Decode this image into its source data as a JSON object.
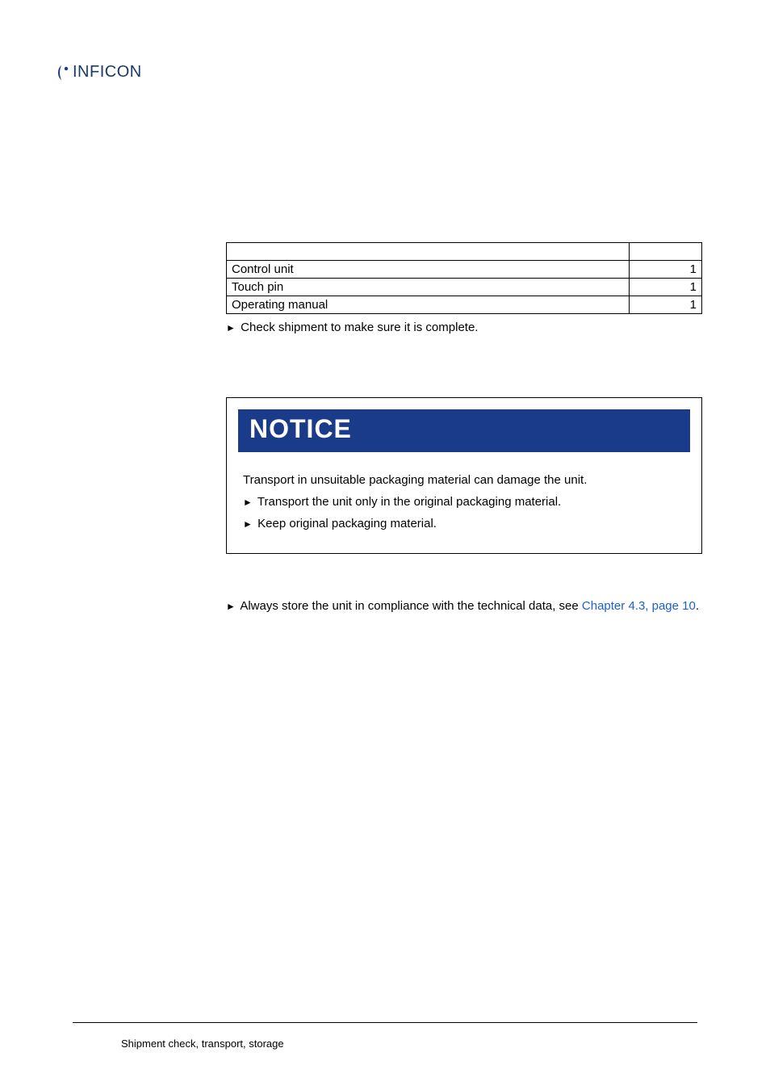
{
  "brand": "INFICON",
  "shipment_table": {
    "rows": [
      {
        "item": "Control unit",
        "qty": "1"
      },
      {
        "item": "Touch pin",
        "qty": "1"
      },
      {
        "item": "Operating manual",
        "qty": "1"
      }
    ]
  },
  "check_line": "Check shipment to make sure it is complete.",
  "notice": {
    "heading": "NOTICE",
    "intro": "Transport in unsuitable packaging material can damage the unit.",
    "b1": "Transport the unit only in the original packaging material.",
    "b2": "Keep original packaging material."
  },
  "storage": {
    "prefix": "Always store the unit in compliance with the technical data, see ",
    "link": "Chapter 4.3, page 10",
    "suffix": "."
  },
  "footer": "Shipment check, transport, storage"
}
